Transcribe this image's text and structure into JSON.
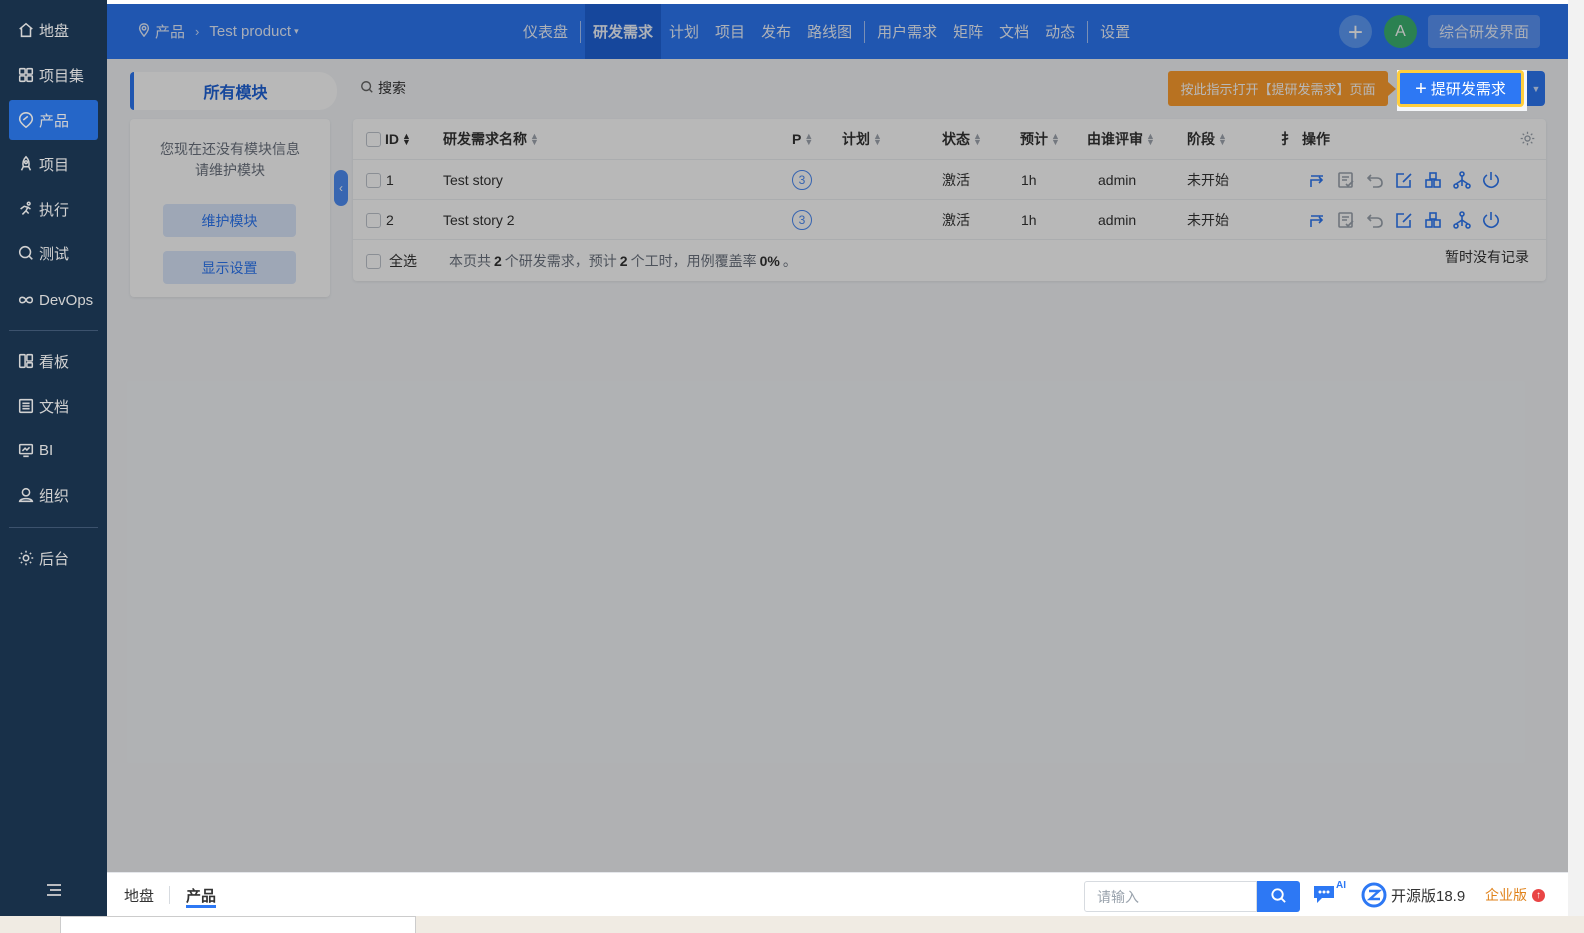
{
  "sidebar": {
    "items": [
      {
        "label": "地盘",
        "icon": "home-icon"
      },
      {
        "label": "项目集",
        "icon": "grid-icon"
      },
      {
        "label": "产品",
        "icon": "product-icon",
        "active": true
      },
      {
        "label": "项目",
        "icon": "project-icon"
      },
      {
        "label": "执行",
        "icon": "run-icon"
      },
      {
        "label": "测试",
        "icon": "test-icon"
      },
      {
        "label": "DevOps",
        "icon": "infinity-icon"
      },
      {
        "label": "看板",
        "icon": "kanban-icon"
      },
      {
        "label": "文档",
        "icon": "doc-icon"
      },
      {
        "label": "BI",
        "icon": "bi-icon"
      },
      {
        "label": "组织",
        "icon": "user-icon"
      },
      {
        "label": "后台",
        "icon": "gear-icon"
      }
    ]
  },
  "header": {
    "breadcrumb": {
      "section": "产品",
      "product": "Test product"
    },
    "tabs": [
      "仪表盘",
      "研发需求",
      "计划",
      "项目",
      "发布",
      "路线图",
      "用户需求",
      "矩阵",
      "文档",
      "动态",
      "设置"
    ],
    "active_tab": "研发需求",
    "avatar_letter": "A",
    "mode_button": "综合研发界面"
  },
  "left_panel": {
    "title": "所有模块",
    "empty_line1": "您现在还没有模块信息",
    "empty_line2": "请维护模块",
    "maintain_button": "维护模块",
    "display_button": "显示设置"
  },
  "toolbar": {
    "search_label": "搜索",
    "guide_tip": "按此指示打开【提研发需求】页面",
    "create_label": "提研发需求"
  },
  "table": {
    "headers": {
      "id": "ID",
      "name": "研发需求名称",
      "pri": "P",
      "plan": "计划",
      "status": "状态",
      "estimate": "预计",
      "reviewer": "由谁评审",
      "stage": "阶段",
      "extra": "扌",
      "actions": "操作"
    },
    "rows": [
      {
        "id": "1",
        "name": "Test story",
        "pri": "3",
        "plan": "",
        "status": "激活",
        "estimate": "1h",
        "reviewer": "admin",
        "stage": "未开始"
      },
      {
        "id": "2",
        "name": "Test story 2",
        "pri": "3",
        "plan": "",
        "status": "激活",
        "estimate": "1h",
        "reviewer": "admin",
        "stage": "未开始"
      }
    ],
    "footer": {
      "select_all": "全选",
      "summary_prefix": "本页共",
      "story_count": "2",
      "summary_mid1": "个研发需求，预计",
      "hours": "2",
      "summary_mid2": "个工时，用例覆盖率",
      "coverage": "0%",
      "summary_suffix": "。",
      "no_records": "暂时没有记录"
    }
  },
  "bottombar": {
    "crumb_home": "地盘",
    "crumb_product": "产品",
    "search_placeholder": "请输入",
    "ai_label": "AI",
    "version": "开源版18.9",
    "enterprise": "企业版",
    "enterprise_badge": "↑"
  },
  "colors": {
    "primary": "#2d78f4",
    "sidebar": "#1e3b5a",
    "guide": "#ff9f2e",
    "highlight_border": "#ffce3d"
  }
}
